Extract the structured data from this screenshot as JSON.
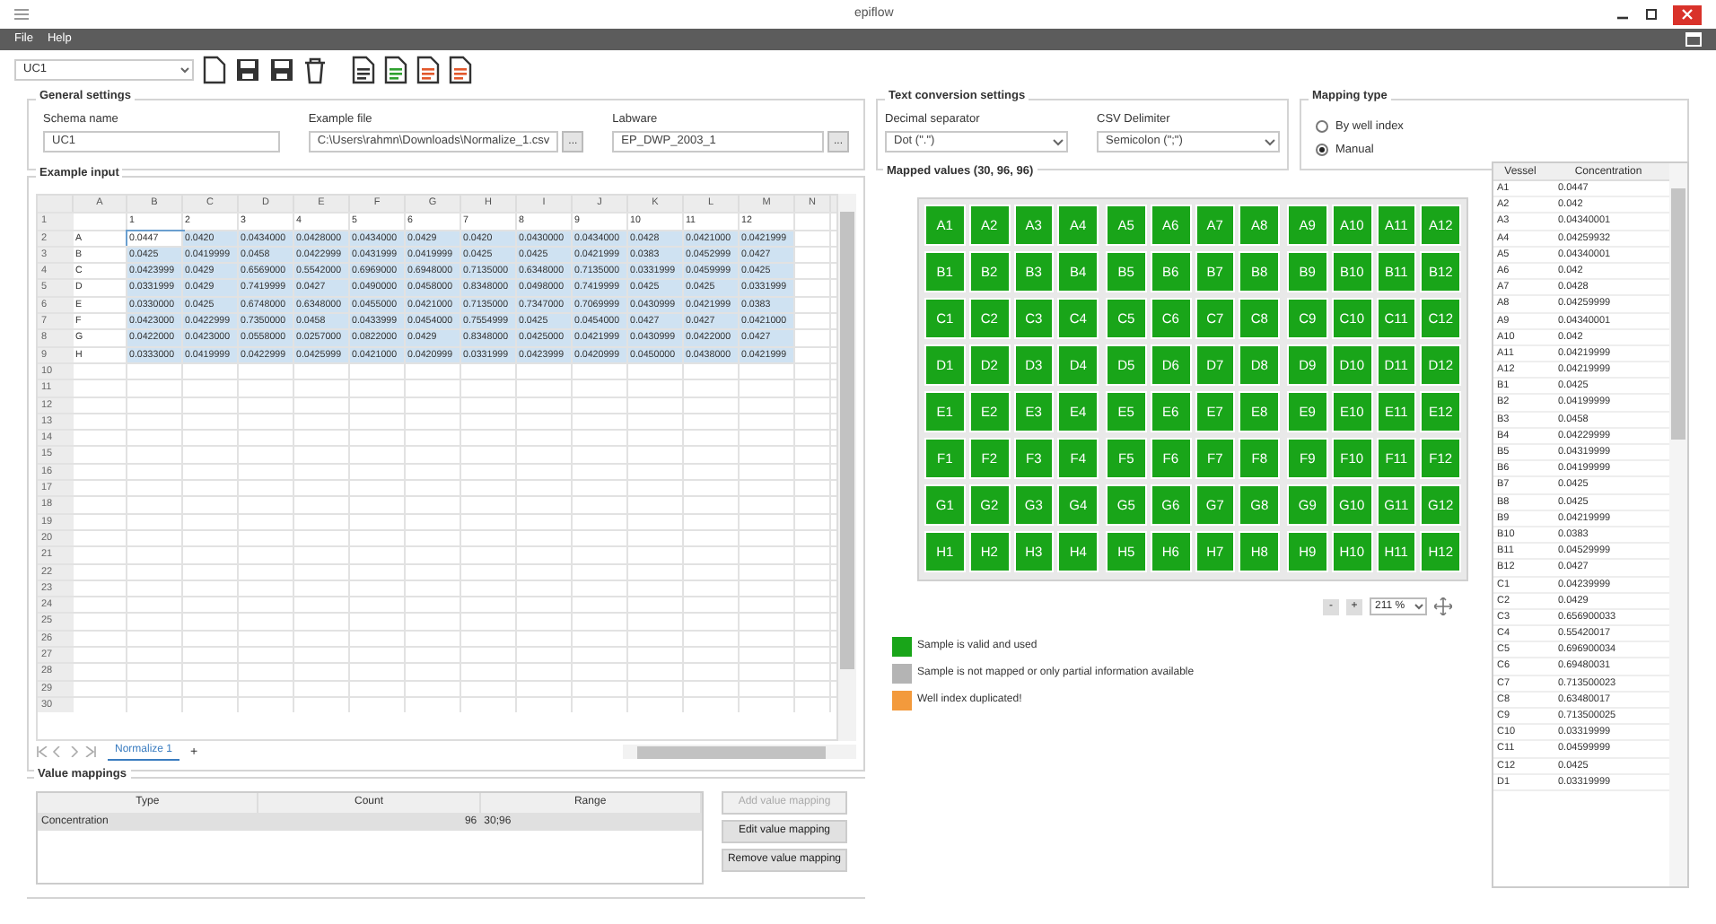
{
  "window": {
    "title": "epiflow"
  },
  "menu": [
    "File",
    "Help"
  ],
  "toolbar": {
    "schema": "UC1"
  },
  "general_settings": {
    "title": "General settings",
    "fields": [
      {
        "label": "Schema name",
        "value": "UC1"
      },
      {
        "label": "Example file",
        "value": "C:\\Users\\rahmn\\Downloads\\Normalize_1.csv",
        "button": "..."
      },
      {
        "label": "Labware",
        "value": "EP_DWP_2003_1",
        "button": "..."
      }
    ]
  },
  "text_conversion": {
    "title": "Text conversion settings",
    "fields": [
      {
        "label": "Decimal separator",
        "value": "Dot (\".\")"
      },
      {
        "label": "CSV Delimiter",
        "value": "Semicolon (\";\")"
      }
    ]
  },
  "mapping_type": {
    "title": "Mapping type",
    "options": [
      {
        "label": "By well index",
        "selected": false
      },
      {
        "label": "Manual",
        "selected": true
      }
    ]
  },
  "example_input": {
    "title": "Example input",
    "columns": [
      "A",
      "B",
      "C",
      "D",
      "E",
      "F",
      "G",
      "H",
      "I",
      "J",
      "K",
      "L",
      "M",
      "N"
    ],
    "rows": [
      {
        "header": "1",
        "selected": false,
        "cells": [
          "",
          "1",
          "2",
          "3",
          "4",
          "5",
          "6",
          "7",
          "8",
          "9",
          "10",
          "11",
          "12"
        ]
      },
      {
        "header": "2",
        "selected": true,
        "cells": [
          "A",
          "0.0447",
          "0.0420",
          "0.0434000",
          "0.0428000",
          "0.0434000",
          "0.0429",
          "0.0420",
          "0.0430000",
          "0.0434000",
          "0.0428",
          "0.0421000",
          "0.0421999"
        ]
      },
      {
        "header": "3",
        "selected": true,
        "cells": [
          "B",
          "0.0425",
          "0.0419999",
          "0.0458",
          "0.0422999",
          "0.0431999",
          "0.0419999",
          "0.0425",
          "0.0425",
          "0.0421999",
          "0.0383",
          "0.0452999",
          "0.0427"
        ]
      },
      {
        "header": "4",
        "selected": true,
        "cells": [
          "C",
          "0.0423999",
          "0.0429",
          "0.6569000",
          "0.5542000",
          "0.6969000",
          "0.6948000",
          "0.7135000",
          "0.6348000",
          "0.7135000",
          "0.0331999",
          "0.0459999",
          "0.0425"
        ]
      },
      {
        "header": "5",
        "selected": true,
        "cells": [
          "D",
          "0.0331999",
          "0.0429",
          "0.7419999",
          "0.0427",
          "0.0490000",
          "0.0458000",
          "0.8348000",
          "0.0498000",
          "0.7419999",
          "0.0425",
          "0.0425",
          "0.0331999"
        ]
      },
      {
        "header": "6",
        "selected": true,
        "cells": [
          "E",
          "0.0330000",
          "0.0425",
          "0.6748000",
          "0.6348000",
          "0.0455000",
          "0.0421000",
          "0.7135000",
          "0.7347000",
          "0.7069999",
          "0.0430999",
          "0.0421999",
          "0.0383"
        ]
      },
      {
        "header": "7",
        "selected": true,
        "cells": [
          "F",
          "0.0423000",
          "0.0422999",
          "0.7350000",
          "0.0458",
          "0.0433999",
          "0.0454000",
          "0.7554999",
          "0.0425",
          "0.0454000",
          "0.0427",
          "0.0427",
          "0.0421000"
        ]
      },
      {
        "header": "8",
        "selected": true,
        "cells": [
          "G",
          "0.0422000",
          "0.0423000",
          "0.0558000",
          "0.0257000",
          "0.0822000",
          "0.0429",
          "0.8348000",
          "0.0425000",
          "0.0421999",
          "0.0430999",
          "0.0422000",
          "0.0427"
        ]
      },
      {
        "header": "9",
        "selected": true,
        "cells": [
          "H",
          "0.0333000",
          "0.0419999",
          "0.0422999",
          "0.0425999",
          "0.0421000",
          "0.0420999",
          "0.0331999",
          "0.0423999",
          "0.0420999",
          "0.0450000",
          "0.0438000",
          "0.0421999"
        ]
      },
      {
        "header": "10",
        "selected": false,
        "cells": []
      },
      {
        "header": "11",
        "selected": false,
        "cells": []
      },
      {
        "header": "12",
        "selected": false,
        "cells": []
      },
      {
        "header": "13",
        "selected": false,
        "cells": []
      },
      {
        "header": "14",
        "selected": false,
        "cells": []
      },
      {
        "header": "15",
        "selected": false,
        "cells": []
      },
      {
        "header": "16",
        "selected": false,
        "cells": []
      },
      {
        "header": "17",
        "selected": false,
        "cells": []
      },
      {
        "header": "18",
        "selected": false,
        "cells": []
      },
      {
        "header": "19",
        "selected": false,
        "cells": []
      },
      {
        "header": "20",
        "selected": false,
        "cells": []
      },
      {
        "header": "21",
        "selected": false,
        "cells": []
      },
      {
        "header": "22",
        "selected": false,
        "cells": []
      },
      {
        "header": "23",
        "selected": false,
        "cells": []
      },
      {
        "header": "24",
        "selected": false,
        "cells": []
      },
      {
        "header": "25",
        "selected": false,
        "cells": []
      },
      {
        "header": "26",
        "selected": false,
        "cells": []
      },
      {
        "header": "27",
        "selected": false,
        "cells": []
      },
      {
        "header": "28",
        "selected": false,
        "cells": []
      },
      {
        "header": "29",
        "selected": false,
        "cells": []
      },
      {
        "header": "30",
        "selected": false,
        "cells": []
      }
    ],
    "sheet_tab": "Normalize 1",
    "add_tab": "+"
  },
  "mapped_values": {
    "title": "Mapped values (30, 96, 96)",
    "plate": [
      [
        "A1",
        "A2",
        "A3",
        "A4",
        "A5",
        "A6",
        "A7",
        "A8",
        "A9",
        "A10",
        "A11",
        "A12"
      ],
      [
        "B1",
        "B2",
        "B3",
        "B4",
        "B5",
        "B6",
        "B7",
        "B8",
        "B9",
        "B10",
        "B11",
        "B12"
      ],
      [
        "C1",
        "C2",
        "C3",
        "C4",
        "C5",
        "C6",
        "C7",
        "C8",
        "C9",
        "C10",
        "C11",
        "C12"
      ],
      [
        "D1",
        "D2",
        "D3",
        "D4",
        "D5",
        "D6",
        "D7",
        "D8",
        "D9",
        "D10",
        "D11",
        "D12"
      ],
      [
        "E1",
        "E2",
        "E3",
        "E4",
        "E5",
        "E6",
        "E7",
        "E8",
        "E9",
        "E10",
        "E11",
        "E12"
      ],
      [
        "F1",
        "F2",
        "F3",
        "F4",
        "F5",
        "F6",
        "F7",
        "F8",
        "F9",
        "F10",
        "F11",
        "F12"
      ],
      [
        "G1",
        "G2",
        "G3",
        "G4",
        "G5",
        "G6",
        "G7",
        "G8",
        "G9",
        "G10",
        "G11",
        "G12"
      ],
      [
        "H1",
        "H2",
        "H3",
        "H4",
        "H5",
        "H6",
        "H7",
        "H8",
        "H9",
        "H10",
        "H11",
        "H12"
      ]
    ],
    "zoom": {
      "minus": "-",
      "plus": "+",
      "value": "211 %"
    },
    "legend": [
      {
        "label": "Sample is valid and used",
        "color": "#19a519"
      },
      {
        "label": "Sample is not mapped or only partial information available",
        "color": "#b4b4b4"
      },
      {
        "label": "Well index duplicated!",
        "color": "#f39a3c"
      }
    ]
  },
  "vessel_table": {
    "columns": [
      "Vessel",
      "Concentration"
    ],
    "rows": [
      [
        "A1",
        "0.0447"
      ],
      [
        "A2",
        "0.042"
      ],
      [
        "A3",
        "0.04340001"
      ],
      [
        "A4",
        "0.04259932"
      ],
      [
        "A5",
        "0.04340001"
      ],
      [
        "A6",
        "0.042"
      ],
      [
        "A7",
        "0.0428"
      ],
      [
        "A8",
        "0.04259999"
      ],
      [
        "A9",
        "0.04340001"
      ],
      [
        "A10",
        "0.042"
      ],
      [
        "A11",
        "0.04219999"
      ],
      [
        "A12",
        "0.04219999"
      ],
      [
        "B1",
        "0.0425"
      ],
      [
        "B2",
        "0.04199999"
      ],
      [
        "B3",
        "0.0458"
      ],
      [
        "B4",
        "0.04229999"
      ],
      [
        "B5",
        "0.04319999"
      ],
      [
        "B6",
        "0.04199999"
      ],
      [
        "B7",
        "0.0425"
      ],
      [
        "B8",
        "0.0425"
      ],
      [
        "B9",
        "0.04219999"
      ],
      [
        "B10",
        "0.0383"
      ],
      [
        "B11",
        "0.04529999"
      ],
      [
        "B12",
        "0.0427"
      ],
      [
        "C1",
        "0.04239999"
      ],
      [
        "C2",
        "0.0429"
      ],
      [
        "C3",
        "0.656900033"
      ],
      [
        "C4",
        "0.55420017"
      ],
      [
        "C5",
        "0.696900034"
      ],
      [
        "C6",
        "0.69480031"
      ],
      [
        "C7",
        "0.713500023"
      ],
      [
        "C8",
        "0.63480017"
      ],
      [
        "C9",
        "0.713500025"
      ],
      [
        "C10",
        "0.03319999"
      ],
      [
        "C11",
        "0.04599999"
      ],
      [
        "C12",
        "0.0425"
      ],
      [
        "D1",
        "0.03319999"
      ]
    ]
  },
  "value_mappings": {
    "title": "Value mappings",
    "columns": [
      "Type",
      "Count",
      "Range"
    ],
    "rows": [
      {
        "cells": [
          "Concentration",
          "96",
          "30;96"
        ],
        "selected": true
      }
    ],
    "buttons": [
      {
        "label": "Add value mapping",
        "disabled": true
      },
      {
        "label": "Edit value mapping",
        "disabled": false
      },
      {
        "label": "Remove value mapping",
        "disabled": false
      }
    ]
  }
}
